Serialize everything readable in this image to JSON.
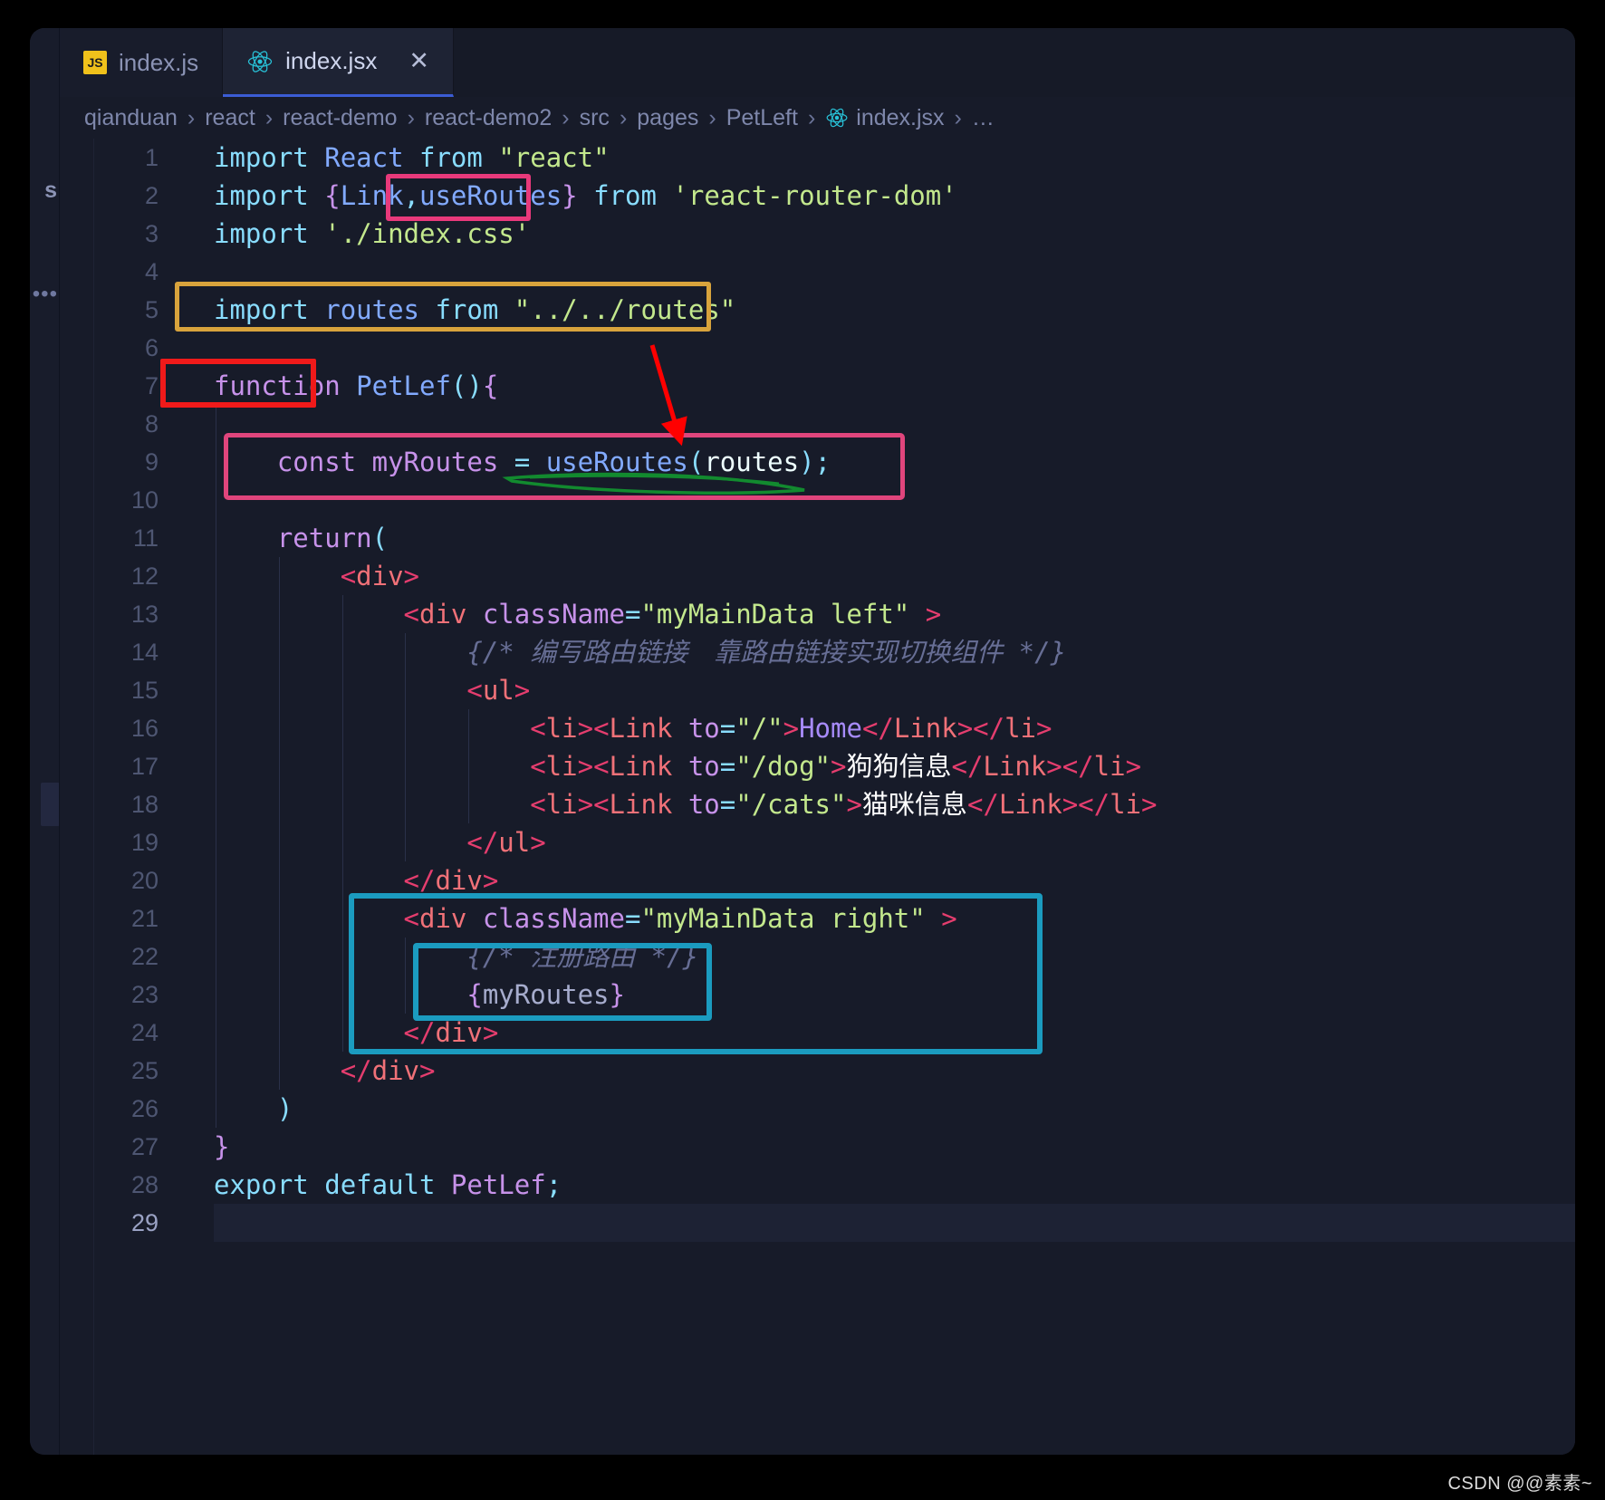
{
  "window": {
    "background_color": "#1c2031",
    "editor_background": "#171b29"
  },
  "sidebar_sliver": {
    "partial_label": "s",
    "ellipsis": "•••"
  },
  "tabs": [
    {
      "label": "index.js",
      "icon": "js-file-icon",
      "active": false,
      "closable": false
    },
    {
      "label": "index.jsx",
      "icon": "react-file-icon",
      "active": true,
      "closable": true,
      "close_label": "✕"
    }
  ],
  "breadcrumb": {
    "separator": "›",
    "items": [
      {
        "label": "qianduan",
        "icon": null
      },
      {
        "label": "react",
        "icon": null
      },
      {
        "label": "react-demo",
        "icon": null
      },
      {
        "label": "react-demo2",
        "icon": null
      },
      {
        "label": "src",
        "icon": null
      },
      {
        "label": "pages",
        "icon": null
      },
      {
        "label": "PetLeft",
        "icon": null
      },
      {
        "label": "index.jsx",
        "icon": "react-file-icon"
      },
      {
        "label": "…",
        "icon": null
      }
    ]
  },
  "editor": {
    "current_line": 29,
    "lines": [
      {
        "n": 1,
        "indent": 0,
        "tokens": [
          {
            "t": "import",
            "c": "t-kw"
          },
          {
            "t": " ",
            "c": "t-plain"
          },
          {
            "t": "React",
            "c": "t-ident"
          },
          {
            "t": " ",
            "c": "t-plain"
          },
          {
            "t": "from",
            "c": "t-kw"
          },
          {
            "t": " ",
            "c": "t-plain"
          },
          {
            "t": "\"react\"",
            "c": "t-str"
          }
        ]
      },
      {
        "n": 2,
        "indent": 0,
        "tokens": [
          {
            "t": "import",
            "c": "t-kw"
          },
          {
            "t": " ",
            "c": "t-plain"
          },
          {
            "t": "{",
            "c": "t-brace"
          },
          {
            "t": "Link",
            "c": "t-named"
          },
          {
            "t": ",",
            "c": "t-punct"
          },
          {
            "t": "useRoutes",
            "c": "t-named"
          },
          {
            "t": "}",
            "c": "t-brace"
          },
          {
            "t": " ",
            "c": "t-plain"
          },
          {
            "t": "from",
            "c": "t-kw"
          },
          {
            "t": " ",
            "c": "t-plain"
          },
          {
            "t": "'react-router-dom'",
            "c": "t-str"
          }
        ]
      },
      {
        "n": 3,
        "indent": 0,
        "tokens": [
          {
            "t": "import",
            "c": "t-kw"
          },
          {
            "t": " ",
            "c": "t-plain"
          },
          {
            "t": "'./index.css'",
            "c": "t-str"
          }
        ]
      },
      {
        "n": 4,
        "indent": 0,
        "tokens": []
      },
      {
        "n": 5,
        "indent": 0,
        "tokens": [
          {
            "t": "import",
            "c": "t-kw"
          },
          {
            "t": " ",
            "c": "t-plain"
          },
          {
            "t": "routes",
            "c": "t-named"
          },
          {
            "t": " ",
            "c": "t-plain"
          },
          {
            "t": "from",
            "c": "t-kw"
          },
          {
            "t": " ",
            "c": "t-plain"
          },
          {
            "t": "\"../../routes\"",
            "c": "t-str"
          }
        ]
      },
      {
        "n": 6,
        "indent": 0,
        "tokens": []
      },
      {
        "n": 7,
        "indent": 0,
        "tokens": [
          {
            "t": "function",
            "c": "t-fnkw"
          },
          {
            "t": " ",
            "c": "t-plain"
          },
          {
            "t": "PetLef",
            "c": "t-fn"
          },
          {
            "t": "()",
            "c": "t-punct"
          },
          {
            "t": "{",
            "c": "t-brace"
          }
        ]
      },
      {
        "n": 8,
        "indent": 1,
        "tokens": []
      },
      {
        "n": 9,
        "indent": 1,
        "tokens": [
          {
            "t": "    ",
            "c": "t-plain"
          },
          {
            "t": "const",
            "c": "t-fnkw"
          },
          {
            "t": " ",
            "c": "t-plain"
          },
          {
            "t": "myRoutes",
            "c": "t-var"
          },
          {
            "t": " ",
            "c": "t-plain"
          },
          {
            "t": "=",
            "c": "t-eq"
          },
          {
            "t": " ",
            "c": "t-plain"
          },
          {
            "t": "useRoutes",
            "c": "t-fn"
          },
          {
            "t": "(",
            "c": "t-punct"
          },
          {
            "t": "routes",
            "c": "t-param"
          },
          {
            "t": ")",
            "c": "t-punct"
          },
          {
            "t": ";",
            "c": "t-semi"
          }
        ]
      },
      {
        "n": 10,
        "indent": 1,
        "tokens": []
      },
      {
        "n": 11,
        "indent": 1,
        "tokens": [
          {
            "t": "    ",
            "c": "t-plain"
          },
          {
            "t": "return",
            "c": "t-fnkw"
          },
          {
            "t": "(",
            "c": "t-punct"
          }
        ]
      },
      {
        "n": 12,
        "indent": 2,
        "tokens": [
          {
            "t": "        ",
            "c": "t-plain"
          },
          {
            "t": "<",
            "c": "t-tagpunct"
          },
          {
            "t": "div",
            "c": "t-tag"
          },
          {
            "t": ">",
            "c": "t-tagpunct"
          }
        ]
      },
      {
        "n": 13,
        "indent": 3,
        "tokens": [
          {
            "t": "            ",
            "c": "t-plain"
          },
          {
            "t": "<",
            "c": "t-tagpunct"
          },
          {
            "t": "div",
            "c": "t-tag"
          },
          {
            "t": " ",
            "c": "t-plain"
          },
          {
            "t": "className",
            "c": "t-attr"
          },
          {
            "t": "=",
            "c": "t-eq"
          },
          {
            "t": "\"myMainData left\"",
            "c": "t-str"
          },
          {
            "t": " ",
            "c": "t-plain"
          },
          {
            "t": ">",
            "c": "t-tagpunct"
          }
        ]
      },
      {
        "n": 14,
        "indent": 4,
        "tokens": [
          {
            "t": "                ",
            "c": "t-plain"
          },
          {
            "t": "{/* 编写路由链接　靠路由链接实现切换组件 */}",
            "c": "t-comment"
          }
        ]
      },
      {
        "n": 15,
        "indent": 4,
        "tokens": [
          {
            "t": "                ",
            "c": "t-plain"
          },
          {
            "t": "<",
            "c": "t-tagpunct"
          },
          {
            "t": "ul",
            "c": "t-tag"
          },
          {
            "t": ">",
            "c": "t-tagpunct"
          }
        ]
      },
      {
        "n": 16,
        "indent": 5,
        "tokens": [
          {
            "t": "                    ",
            "c": "t-plain"
          },
          {
            "t": "<",
            "c": "t-tagpunct"
          },
          {
            "t": "li",
            "c": "t-tag"
          },
          {
            "t": ">",
            "c": "t-tagpunct"
          },
          {
            "t": "<",
            "c": "t-tagpunct"
          },
          {
            "t": "Link",
            "c": "t-tag"
          },
          {
            "t": " ",
            "c": "t-plain"
          },
          {
            "t": "to",
            "c": "t-attr"
          },
          {
            "t": "=",
            "c": "t-eq"
          },
          {
            "t": "\"/\"",
            "c": "t-str"
          },
          {
            "t": ">",
            "c": "t-tagpunct"
          },
          {
            "t": "Home",
            "c": "t-comp"
          },
          {
            "t": "</",
            "c": "t-tagpunct"
          },
          {
            "t": "Link",
            "c": "t-tag"
          },
          {
            "t": ">",
            "c": "t-tagpunct"
          },
          {
            "t": "</",
            "c": "t-tagpunct"
          },
          {
            "t": "li",
            "c": "t-tag"
          },
          {
            "t": ">",
            "c": "t-tagpunct"
          }
        ]
      },
      {
        "n": 17,
        "indent": 5,
        "tokens": [
          {
            "t": "                    ",
            "c": "t-plain"
          },
          {
            "t": "<",
            "c": "t-tagpunct"
          },
          {
            "t": "li",
            "c": "t-tag"
          },
          {
            "t": ">",
            "c": "t-tagpunct"
          },
          {
            "t": "<",
            "c": "t-tagpunct"
          },
          {
            "t": "Link",
            "c": "t-tag"
          },
          {
            "t": " ",
            "c": "t-plain"
          },
          {
            "t": "to",
            "c": "t-attr"
          },
          {
            "t": "=",
            "c": "t-eq"
          },
          {
            "t": "\"/dog\"",
            "c": "t-str"
          },
          {
            "t": ">",
            "c": "t-tagpunct"
          },
          {
            "t": "狗狗信息",
            "c": "t-textcn"
          },
          {
            "t": "</",
            "c": "t-tagpunct"
          },
          {
            "t": "Link",
            "c": "t-tag"
          },
          {
            "t": ">",
            "c": "t-tagpunct"
          },
          {
            "t": "</",
            "c": "t-tagpunct"
          },
          {
            "t": "li",
            "c": "t-tag"
          },
          {
            "t": ">",
            "c": "t-tagpunct"
          }
        ]
      },
      {
        "n": 18,
        "indent": 5,
        "tokens": [
          {
            "t": "                    ",
            "c": "t-plain"
          },
          {
            "t": "<",
            "c": "t-tagpunct"
          },
          {
            "t": "li",
            "c": "t-tag"
          },
          {
            "t": ">",
            "c": "t-tagpunct"
          },
          {
            "t": "<",
            "c": "t-tagpunct"
          },
          {
            "t": "Link",
            "c": "t-tag"
          },
          {
            "t": " ",
            "c": "t-plain"
          },
          {
            "t": "to",
            "c": "t-attr"
          },
          {
            "t": "=",
            "c": "t-eq"
          },
          {
            "t": "\"/cats\"",
            "c": "t-str"
          },
          {
            "t": ">",
            "c": "t-tagpunct"
          },
          {
            "t": "猫咪信息",
            "c": "t-textcn"
          },
          {
            "t": "</",
            "c": "t-tagpunct"
          },
          {
            "t": "Link",
            "c": "t-tag"
          },
          {
            "t": ">",
            "c": "t-tagpunct"
          },
          {
            "t": "</",
            "c": "t-tagpunct"
          },
          {
            "t": "li",
            "c": "t-tag"
          },
          {
            "t": ">",
            "c": "t-tagpunct"
          }
        ]
      },
      {
        "n": 19,
        "indent": 4,
        "tokens": [
          {
            "t": "                ",
            "c": "t-plain"
          },
          {
            "t": "</",
            "c": "t-tagpunct"
          },
          {
            "t": "ul",
            "c": "t-tag"
          },
          {
            "t": ">",
            "c": "t-tagpunct"
          }
        ]
      },
      {
        "n": 20,
        "indent": 3,
        "tokens": [
          {
            "t": "            ",
            "c": "t-plain"
          },
          {
            "t": "</",
            "c": "t-tagpunct"
          },
          {
            "t": "div",
            "c": "t-tag"
          },
          {
            "t": ">",
            "c": "t-tagpunct"
          }
        ]
      },
      {
        "n": 21,
        "indent": 3,
        "tokens": [
          {
            "t": "            ",
            "c": "t-plain"
          },
          {
            "t": "<",
            "c": "t-tagpunct"
          },
          {
            "t": "div",
            "c": "t-tag"
          },
          {
            "t": " ",
            "c": "t-plain"
          },
          {
            "t": "className",
            "c": "t-attr"
          },
          {
            "t": "=",
            "c": "t-eq"
          },
          {
            "t": "\"myMainData right\"",
            "c": "t-str"
          },
          {
            "t": " ",
            "c": "t-plain"
          },
          {
            "t": ">",
            "c": "t-tagpunct"
          }
        ]
      },
      {
        "n": 22,
        "indent": 4,
        "tokens": [
          {
            "t": "                ",
            "c": "t-plain"
          },
          {
            "t": "{/* 注册路由 */}",
            "c": "t-comment"
          }
        ]
      },
      {
        "n": 23,
        "indent": 4,
        "tokens": [
          {
            "t": "                ",
            "c": "t-plain"
          },
          {
            "t": "{",
            "c": "t-brace"
          },
          {
            "t": "myRoutes",
            "c": "t-text"
          },
          {
            "t": "}",
            "c": "t-brace"
          }
        ]
      },
      {
        "n": 24,
        "indent": 3,
        "tokens": [
          {
            "t": "            ",
            "c": "t-plain"
          },
          {
            "t": "</",
            "c": "t-tagpunct"
          },
          {
            "t": "div",
            "c": "t-tag"
          },
          {
            "t": ">",
            "c": "t-tagpunct"
          }
        ]
      },
      {
        "n": 25,
        "indent": 2,
        "tokens": [
          {
            "t": "        ",
            "c": "t-plain"
          },
          {
            "t": "</",
            "c": "t-tagpunct"
          },
          {
            "t": "div",
            "c": "t-tag"
          },
          {
            "t": ">",
            "c": "t-tagpunct"
          }
        ]
      },
      {
        "n": 26,
        "indent": 1,
        "tokens": [
          {
            "t": "    ",
            "c": "t-plain"
          },
          {
            "t": ")",
            "c": "t-punct"
          }
        ]
      },
      {
        "n": 27,
        "indent": 0,
        "tokens": [
          {
            "t": "}",
            "c": "t-brace"
          }
        ]
      },
      {
        "n": 28,
        "indent": 0,
        "tokens": [
          {
            "t": "export",
            "c": "t-kw"
          },
          {
            "t": " ",
            "c": "t-plain"
          },
          {
            "t": "default",
            "c": "t-kw"
          },
          {
            "t": " ",
            "c": "t-plain"
          },
          {
            "t": "PetLef",
            "c": "t-var"
          },
          {
            "t": ";",
            "c": "t-semi"
          }
        ]
      },
      {
        "n": 29,
        "indent": 0,
        "tokens": []
      }
    ]
  },
  "annotations": [
    {
      "name": "use-routes-import-highlight",
      "shape": "rect",
      "color": "#e8397b",
      "target": "useRoutes in import on line 2"
    },
    {
      "name": "routes-import-highlight",
      "shape": "rect",
      "color": "#d8a33c",
      "target": "import routes from \"../../routes\" on line 5"
    },
    {
      "name": "function-keyword-highlight",
      "shape": "rect",
      "color": "#f01a1a",
      "target": "function keyword on line 7"
    },
    {
      "name": "use-routes-call-highlight",
      "shape": "rect",
      "color": "#e0457c",
      "target": "const myRoutes = useRoutes(routes); on line 9"
    },
    {
      "name": "right-div-highlight",
      "shape": "rect",
      "color": "#1b9bbf",
      "target": "div className myMainData right block lines 21-24"
    },
    {
      "name": "my-routes-highlight",
      "shape": "rect",
      "color": "#1b9bbf",
      "target": "register routes comment and myRoutes lines 22-23"
    },
    {
      "name": "routes-import-arrow",
      "shape": "arrow",
      "color": "#ff0000",
      "target": "from routes import down to useRoutes(routes) call"
    },
    {
      "name": "use-routes-underline",
      "shape": "underline",
      "color": "#128a2f",
      "target": "underline below useRoutes(routes)"
    }
  ],
  "watermark": {
    "text": "CSDN @@素素~"
  }
}
